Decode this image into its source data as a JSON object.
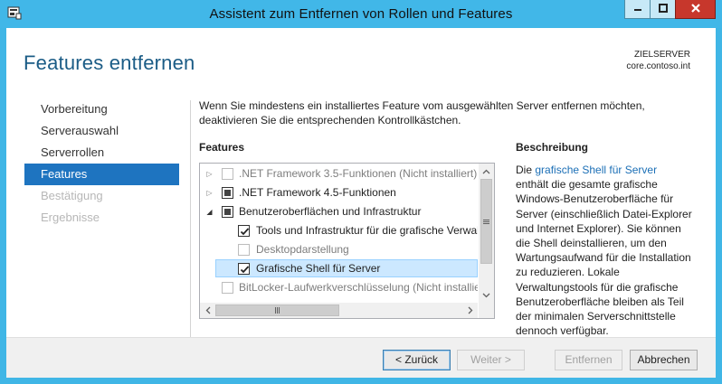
{
  "window": {
    "title": "Assistent zum Entfernen von Rollen und Features"
  },
  "page": {
    "title": "Features entfernen",
    "server_label": "ZIELSERVER",
    "server_name": "core.contoso.int"
  },
  "nav": {
    "items": [
      {
        "label": "Vorbereitung",
        "state": "normal"
      },
      {
        "label": "Serverauswahl",
        "state": "normal"
      },
      {
        "label": "Serverrollen",
        "state": "normal"
      },
      {
        "label": "Features",
        "state": "active"
      },
      {
        "label": "Bestätigung",
        "state": "disabled"
      },
      {
        "label": "Ergebnisse",
        "state": "disabled"
      }
    ]
  },
  "main": {
    "intro": "Wenn Sie mindestens ein installiertes Feature vom ausgewählten Server entfernen möchten, deaktivieren Sie die entsprechenden Kontrollkästchen.",
    "features_heading": "Features",
    "description_heading": "Beschreibung",
    "features": [
      {
        "label": ".NET Framework 3.5-Funktionen (Nicht installiert)",
        "check": "none",
        "expander": "collapsed",
        "disabled": true
      },
      {
        "label": ".NET Framework 4.5-Funktionen",
        "check": "partial",
        "expander": "collapsed",
        "disabled": false
      },
      {
        "label": "Benutzeroberflächen und Infrastruktur",
        "check": "partial",
        "expander": "expanded",
        "disabled": false
      },
      {
        "label": "Tools und Infrastruktur für die grafische Verwaltung",
        "check": "checked",
        "expander": "none",
        "disabled": false
      },
      {
        "label": "Desktopdarstellung",
        "check": "none",
        "expander": "none",
        "disabled": true
      },
      {
        "label": "Grafische Shell für Server",
        "check": "checked",
        "expander": "none",
        "disabled": false,
        "selected": true
      },
      {
        "label": "BitLocker-Laufwerkverschlüsselung (Nicht installiert)",
        "check": "none",
        "expander": "none",
        "disabled": true
      }
    ],
    "description": {
      "prefix": "Die ",
      "link": "grafische Shell für Server",
      "body": " enthält die gesamte grafische Windows-Benutzeroberfläche für Server (einschließlich Datei-Explorer und Internet Explorer). Sie können die Shell deinstallieren, um den Wartungsaufwand für die Installation zu reduzieren. Lokale Verwaltungstools für die grafische Benutzeroberfläche bleiben als Teil der minimalen Serverschnittstelle dennoch verfügbar."
    }
  },
  "footer": {
    "back": "< Zurück",
    "next": "Weiter >",
    "remove": "Entfernen",
    "cancel": "Abbrechen"
  },
  "colors": {
    "title_bar": "#41b7e8",
    "accent": "#1e74c0",
    "heading": "#1b5c86",
    "close_button": "#c7372c"
  }
}
